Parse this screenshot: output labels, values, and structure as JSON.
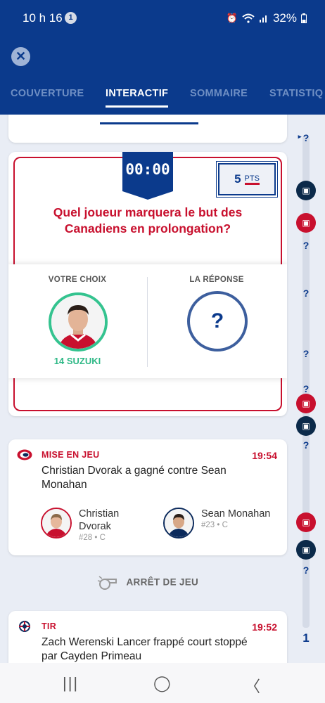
{
  "status_bar": {
    "time": "10 h 16",
    "notification_count": "1",
    "battery": "32%",
    "icons": [
      "alarm-icon",
      "wifi-icon",
      "signal-icon",
      "battery-icon"
    ]
  },
  "header": {
    "close_icon": "close-icon",
    "tabs": [
      {
        "label": "COUVERTURE",
        "active": false
      },
      {
        "label": "INTERACTIF",
        "active": true
      },
      {
        "label": "SOMMAIRE",
        "active": false
      },
      {
        "label": "STATISTIQ",
        "active": false
      }
    ]
  },
  "prediction": {
    "timer": "00:00",
    "points_value": "5",
    "points_label": "PTS",
    "question": "Quel joueur marquera le but des Canadiens en prolongation?",
    "your_choice_label": "VOTRE CHOIX",
    "answer_label": "LA RÉPONSE",
    "chosen_player": "14 SUZUKI",
    "answer_placeholder": "?"
  },
  "events": [
    {
      "type": "MISE EN JEU",
      "time": "19:54",
      "description": "Christian Dvorak a gagné contre Sean Monahan",
      "players": [
        {
          "name": "Christian Dvorak",
          "meta": "#28 • C"
        },
        {
          "name": "Sean Monahan",
          "meta": "#23 • C"
        }
      ]
    },
    {
      "type": "TIR",
      "time": "19:52",
      "description": "Zach Werenski Lancer frappé court stoppé par Cayden Primeau"
    }
  ],
  "stoppage_label": "ARRÊT DE JEU",
  "timeline": {
    "marker": "?",
    "period": "1"
  },
  "colors": {
    "navy": "#0b3a8c",
    "red": "#c8102e",
    "green": "#2eb886"
  },
  "navbar": {
    "recent": "|||",
    "home": "◯",
    "back": "〈"
  }
}
